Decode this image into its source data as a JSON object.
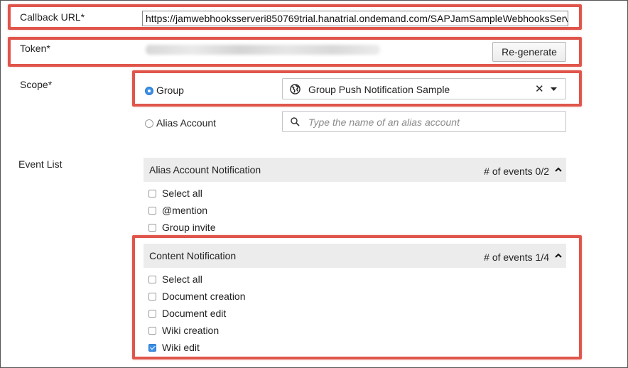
{
  "callback": {
    "label": "Callback URL*",
    "value": "https://jamwebhooksserveri850769trial.hanatrial.ondemand.com/SAPJamSampleWebhooksServ"
  },
  "token": {
    "label": "Token*",
    "regenerate_label": "Re-generate"
  },
  "scope": {
    "label": "Scope*",
    "group": {
      "label": "Group",
      "selected": true,
      "value": "Group Push Notification Sample",
      "clear_glyph": "✕"
    },
    "alias": {
      "label": "Alias Account",
      "selected": false,
      "placeholder": "Type the name of an alias account"
    }
  },
  "events": {
    "label": "Event List",
    "sections": [
      {
        "title": "Alias Account Notification",
        "count": "# of events 0/2",
        "items": [
          {
            "label": "Select all",
            "checked": false
          },
          {
            "label": "@mention",
            "checked": false
          },
          {
            "label": "Group invite",
            "checked": false
          }
        ]
      },
      {
        "title": "Content Notification",
        "count": "# of events 1/4",
        "items": [
          {
            "label": "Select all",
            "checked": false
          },
          {
            "label": "Document creation",
            "checked": false
          },
          {
            "label": "Document edit",
            "checked": false
          },
          {
            "label": "Wiki creation",
            "checked": false
          },
          {
            "label": "Wiki edit",
            "checked": true
          }
        ]
      }
    ]
  },
  "colors": {
    "highlight": "#e0554b",
    "accent": "#3a8fe8",
    "section_bg": "#ececec"
  }
}
